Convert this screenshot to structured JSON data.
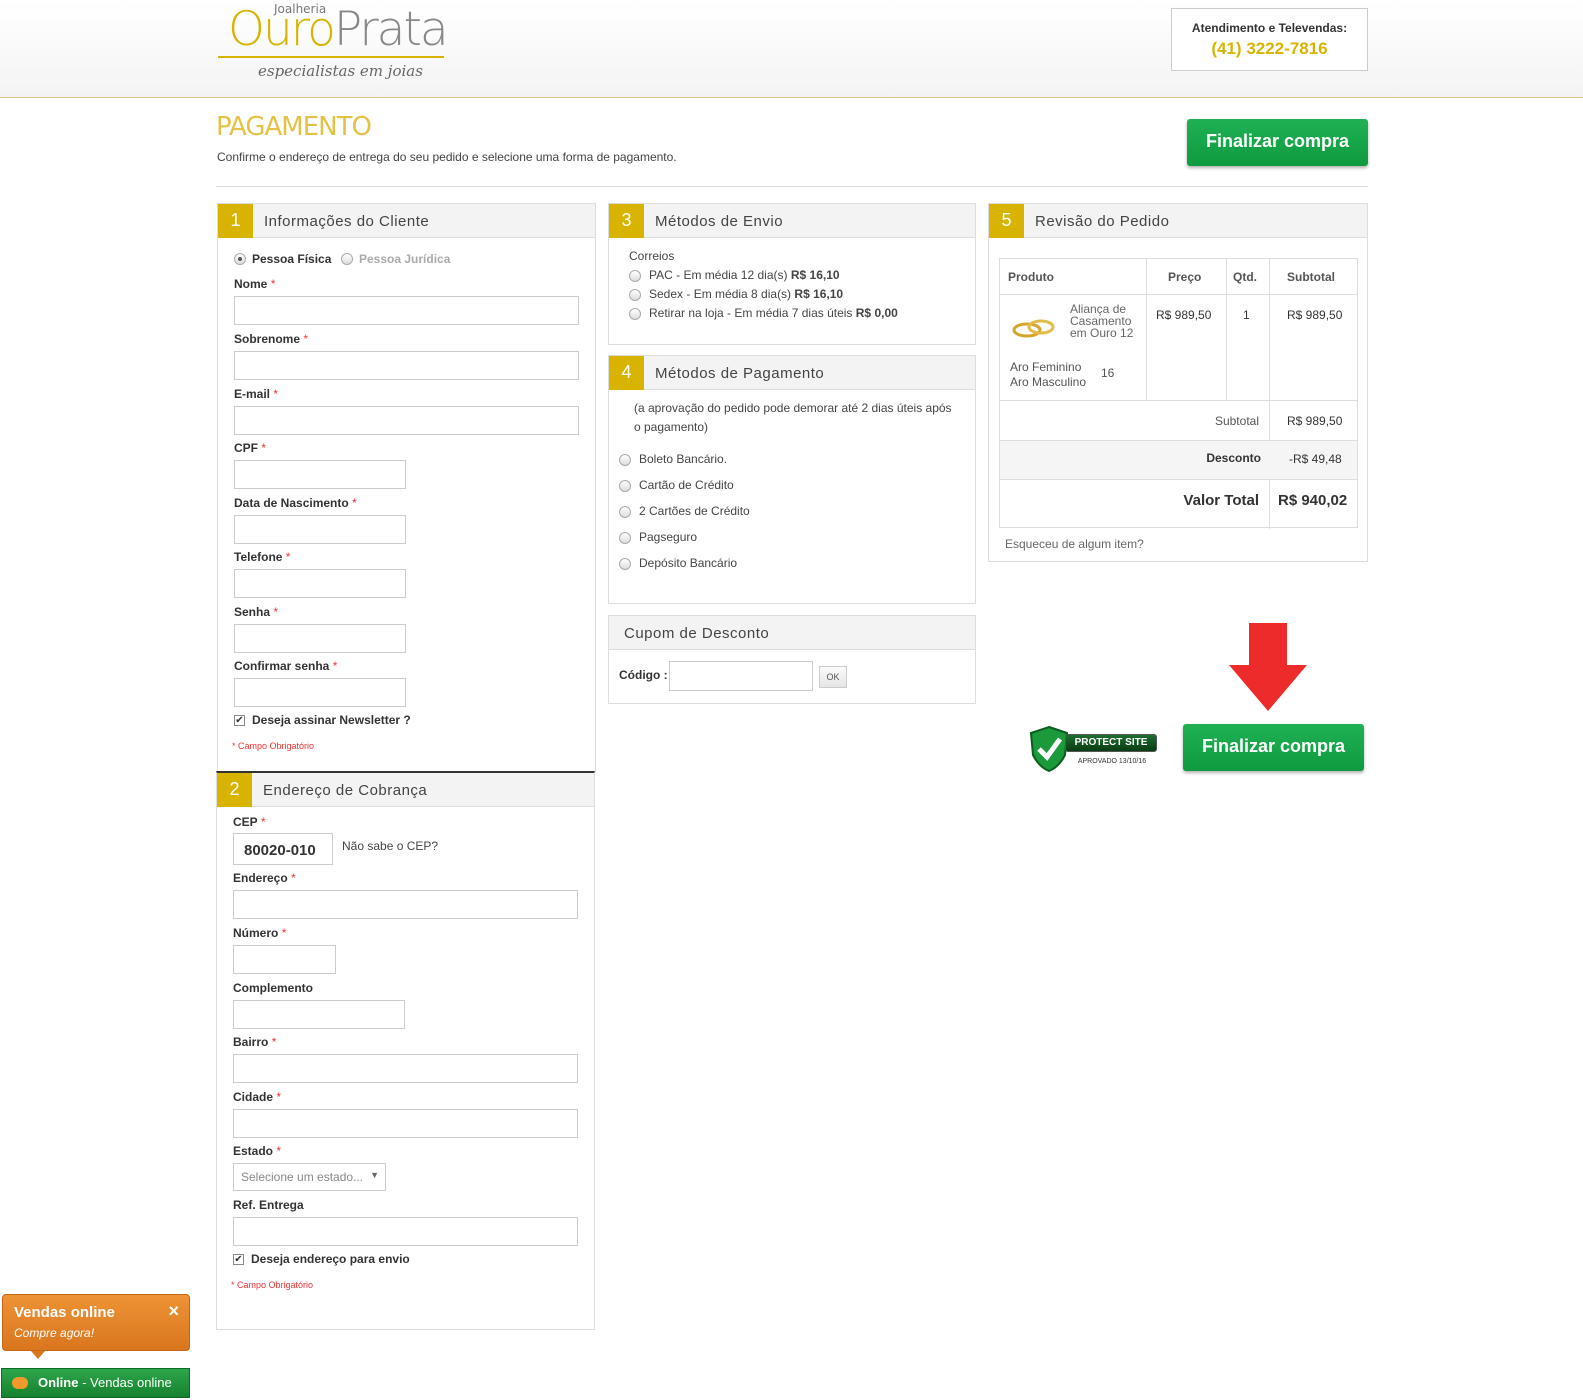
{
  "header": {
    "logo_small": "Joalheria",
    "logo_ouro": "Ouro",
    "logo_prata": "Prata",
    "logo_tagline": "especialistas em joias",
    "phone_label": "Atendimento e Televendas:",
    "phone_number": "(41) 3222-7816"
  },
  "page": {
    "title": "PAGAMENTO",
    "subtitle": "Confirme o endereço de entrega do seu pedido e selecione uma forma de pagamento.",
    "finalize_label": "Finalizar compra"
  },
  "customer": {
    "number": "1",
    "title": "Informações do Cliente",
    "person_fisica": "Pessoa Física",
    "person_juridica": "Pessoa Jurídica",
    "fields": {
      "nome": "Nome",
      "sobrenome": "Sobrenome",
      "email": "E-mail",
      "cpf": "CPF",
      "nascimento": "Data de Nascimento",
      "telefone": "Telefone",
      "senha": "Senha",
      "confirmar": "Confirmar senha"
    },
    "required_mark": "*",
    "newsletter": "Deseja assinar Newsletter ?",
    "required_note": "* Campo Obrigatório"
  },
  "billing": {
    "number": "2",
    "title": "Endereço de Cobrança",
    "fields": {
      "cep": "CEP",
      "endereco": "Endereço",
      "numero": "Número",
      "complemento": "Complemento",
      "bairro": "Bairro",
      "cidade": "Cidade",
      "estado": "Estado",
      "ref": "Ref. Entrega"
    },
    "cep_value": "80020-010",
    "cep_help": "Não sabe o CEP?",
    "estado_placeholder": "Selecione um estado...",
    "ship_same": "Deseja endereço para envio",
    "required_note": "* Campo Obrigatório"
  },
  "shipping": {
    "number": "3",
    "title": "Métodos de Envio",
    "carrier": "Correios",
    "options": [
      {
        "label": "PAC - Em média 12 dia(s)",
        "price": "R$ 16,10"
      },
      {
        "label": "Sedex - Em média 8 dia(s)",
        "price": "R$ 16,10"
      },
      {
        "label": "Retirar na loja - Em média 7 dias úteis",
        "price": "R$ 0,00"
      }
    ]
  },
  "payment": {
    "number": "4",
    "title": "Métodos de Pagamento",
    "note": "(a aprovação do pedido pode demorar até 2 dias úteis após o pagamento)",
    "options": [
      "Boleto Bancário.",
      "Cartão de Crédito",
      "2 Cartões de Crédito",
      "Pagseguro",
      "Depósito Bancário"
    ]
  },
  "coupon": {
    "title": "Cupom de Desconto",
    "code_label": "Código :",
    "ok": "OK"
  },
  "review": {
    "number": "5",
    "title": "Revisão do Pedido",
    "headers": [
      "Produto",
      "Preço",
      "Qtd.",
      "Subtotal"
    ],
    "product_name": "Aliança de Casamento em Ouro 12",
    "product_size_f": "Aro Feminino",
    "product_size_m": "Aro Masculino",
    "product_size_val": "16",
    "price": "R$ 989,50",
    "qty": "1",
    "subtotal": "R$ 989,50",
    "subtotal_label": "Subtotal",
    "subtotal_value": "R$ 989,50",
    "discount_label": "Desconto",
    "discount_value": "-R$ 49,48",
    "total_label": "Valor Total",
    "total_value": "R$ 940,02",
    "forgot": "Esqueceu de algum item?"
  },
  "badge": {
    "text": "PROTECT SITE",
    "date": "APROVADO 13/10/16"
  },
  "chat": {
    "title": "Vendas online",
    "sub": "Compre agora!",
    "close": "×",
    "bar_status": "Online",
    "bar_text": " - Vendas online"
  },
  "colors": {
    "gold": "#d8b400",
    "green": "#14a347",
    "orange": "#e2842a",
    "red": "#ee2b2b"
  }
}
